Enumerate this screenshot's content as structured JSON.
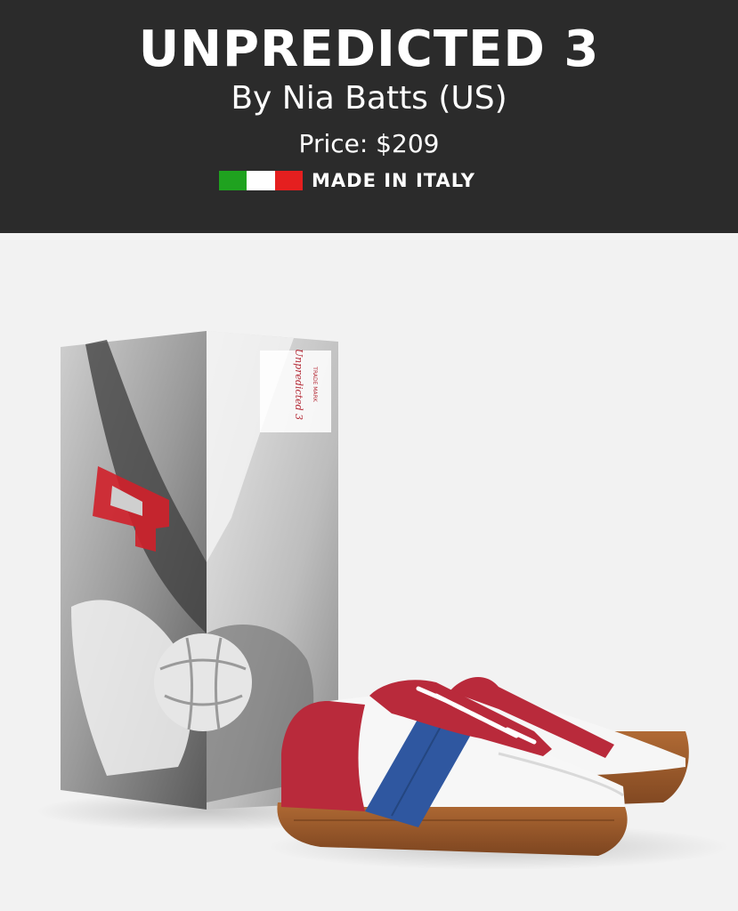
{
  "product": {
    "title": "UNPREDICTED 3",
    "designer": "By Nia Batts (US)",
    "price": "Price: $209",
    "origin": "MADE IN ITALY"
  },
  "box_label": {
    "brand": "Unpredicted 3",
    "subtitle": "TRADE MARK",
    "jersey_number": "4"
  },
  "colors": {
    "header_bg": "#2b2b2b",
    "page_bg": "#f2f2f2",
    "shoe_red": "#b92a3b",
    "shoe_blue": "#2f57a0",
    "sole_brown": "#9a5a2c",
    "flag_green": "#1fa21f",
    "flag_red": "#e51f1f"
  }
}
